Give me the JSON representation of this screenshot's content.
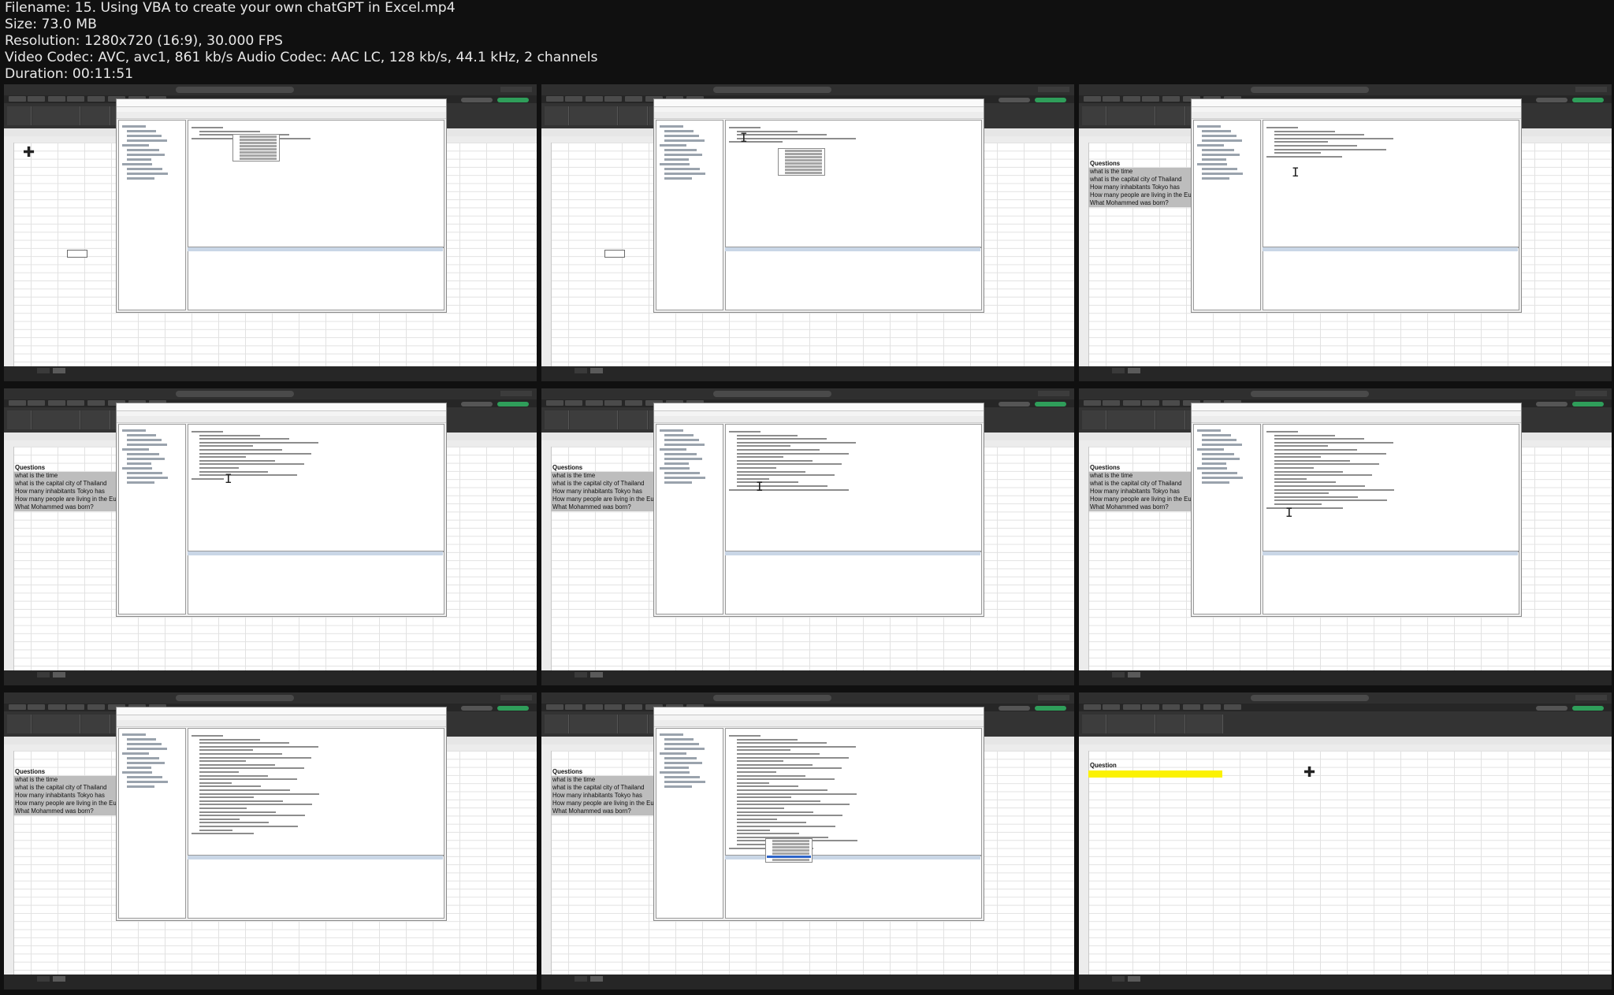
{
  "header": {
    "filename": "Filename: 15. Using VBA to create your own chatGPT in Excel.mp4",
    "size": "Size: 73.0 MB",
    "resolution": "Resolution: 1280x720 (16:9), 30.000 FPS",
    "codec": "Video Codec: AVC, avc1, 861 kb/s Audio Codec: AAC LC, 128 kb/s, 44.1 kHz, 2 channels",
    "duration": "Duration: 00:11:51"
  },
  "questions": {
    "title": "Questions",
    "items": [
      "what is the time",
      "what is the capital city of Thailand",
      "How many inhabitants Tokyo has",
      "How many people are living in the Europ",
      "What Mohammed was born?"
    ]
  },
  "single_question": {
    "title": "Question"
  },
  "colors": {
    "highlight_yellow": "#fbf203",
    "selection_gray": "#bdbdbd",
    "excel_ribbon_green": "#2f9e5a"
  },
  "icons": {
    "text_cursor": "I",
    "crosshair_cursor": "✚"
  }
}
